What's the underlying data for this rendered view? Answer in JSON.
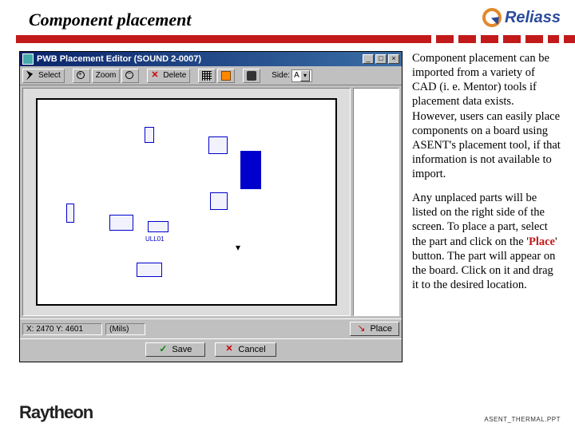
{
  "header": {
    "title": "Component placement",
    "brand": "Reliass"
  },
  "window": {
    "title": "PWB Placement Editor (SOUND  2-0007)",
    "toolbar": {
      "select": "Select",
      "zoom": "Zoom",
      "delete": "Delete",
      "side_label": "Side:",
      "side_value": "A"
    },
    "status": {
      "x_label": "X:",
      "x_value": "2470",
      "y_label": "Y:",
      "y_value": "4601",
      "units": "(Mils)"
    },
    "buttons": {
      "place": "Place",
      "save": "Save",
      "cancel": "Cancel"
    },
    "component_label": "ULL01"
  },
  "body": {
    "para1": "Component placement can be imported from a variety of CAD (i. e. Mentor) tools if placement data exists. However, users can easily place components on a board using ASENT's placement tool, if that information is not available to import.",
    "para2a": "Any unplaced parts will be listed on the right side of the screen. To place a part, select the part and click on the ",
    "para2_place_open": "'",
    "para2_place_word": "Place",
    "para2_place_close": "'",
    "para2b": " button. The part will appear on the board. Click on it and drag it to the desired location."
  },
  "footer": {
    "logo": "Raytheon",
    "file": "ASENT_THERMAL.PPT"
  }
}
